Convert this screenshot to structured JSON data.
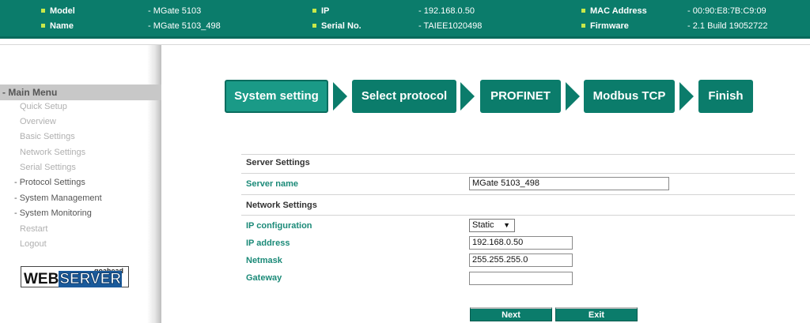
{
  "device_info": {
    "model_label": "Model",
    "model_value": "- MGate 5103",
    "name_label": "Name",
    "name_value": "- MGate 5103_498",
    "ip_label": "IP",
    "ip_value": "- 192.168.0.50",
    "serial_label": "Serial No.",
    "serial_value": "- TAIEE1020498",
    "mac_label": "MAC Address",
    "mac_value": "- 00:90:E8:7B:C9:09",
    "firmware_label": "Firmware",
    "firmware_value": "- 2.1 Build 19052722"
  },
  "sidebar": {
    "header": "- Main Menu",
    "items": [
      {
        "label": "Quick Setup"
      },
      {
        "label": "Overview"
      },
      {
        "label": "Basic Settings"
      },
      {
        "label": "Network Settings"
      },
      {
        "label": "Serial Settings"
      },
      {
        "label": "- Protocol Settings"
      },
      {
        "label": "- System Management"
      },
      {
        "label": "- System Monitoring"
      },
      {
        "label": "Restart"
      },
      {
        "label": "Logout"
      }
    ],
    "logo_small": "goahead",
    "logo_big_a": "WEB",
    "logo_big_b": "SERVER"
  },
  "wizard": {
    "steps": [
      {
        "label": "System setting"
      },
      {
        "label": "Select protocol"
      },
      {
        "label": "PROFINET"
      },
      {
        "label": "Modbus TCP"
      },
      {
        "label": "Finish"
      }
    ]
  },
  "form": {
    "server_section": "Server Settings",
    "server_name_label": "Server name",
    "server_name_value": "MGate 5103_498",
    "network_section": "Network Settings",
    "ip_config_label": "IP configuration",
    "ip_config_value": "Static",
    "ip_address_label": "IP address",
    "ip_address_value": "192.168.0.50",
    "netmask_label": "Netmask",
    "netmask_value": "255.255.255.0",
    "gateway_label": "Gateway",
    "gateway_value": ""
  },
  "actions": {
    "next_label": "Next",
    "exit_label": "Exit"
  },
  "colors": {
    "accent": "#0b7c6b",
    "active_step": "#1a9a87",
    "label_green": "#1b8a78"
  }
}
